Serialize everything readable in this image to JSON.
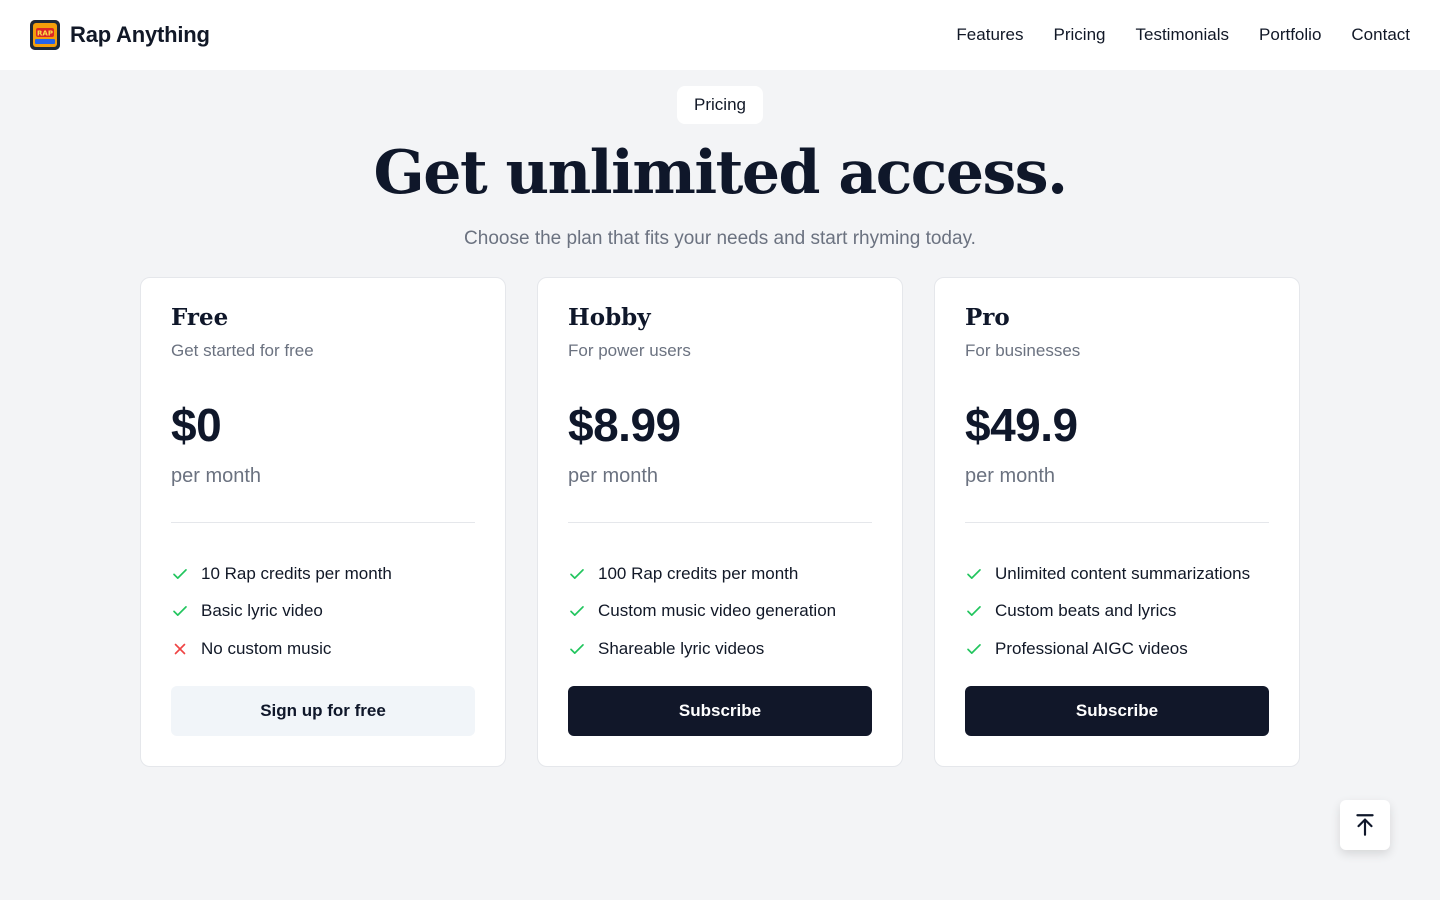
{
  "header": {
    "brand_name": "Rap Anything",
    "logo_text": "RAP",
    "nav": [
      "Features",
      "Pricing",
      "Testimonials",
      "Portfolio",
      "Contact"
    ]
  },
  "hero": {
    "badge": "Pricing",
    "title": "Get unlimited access.",
    "subtitle": "Choose the plan that fits your needs and start rhyming today."
  },
  "plans": [
    {
      "name": "Free",
      "description": "Get started for free",
      "price": "$0",
      "period": "per month",
      "features": [
        {
          "text": "10 Rap credits per month",
          "icon": "check-icon",
          "included": true
        },
        {
          "text": "Basic lyric video",
          "icon": "check-icon",
          "included": true
        },
        {
          "text": "No custom music",
          "icon": "x-icon",
          "included": false
        }
      ],
      "button": "Sign up for free",
      "button_style": "light"
    },
    {
      "name": "Hobby",
      "description": "For power users",
      "price": "$8.99",
      "period": "per month",
      "features": [
        {
          "text": "100 Rap credits per month",
          "icon": "check-icon",
          "included": true
        },
        {
          "text": "Custom music video generation",
          "icon": "check-icon",
          "included": true
        },
        {
          "text": "Shareable lyric videos",
          "icon": "check-icon",
          "included": true
        }
      ],
      "button": "Subscribe",
      "button_style": "dark"
    },
    {
      "name": "Pro",
      "description": "For businesses",
      "price": "$49.9",
      "period": "per month",
      "features": [
        {
          "text": "Unlimited content summarizations",
          "icon": "check-icon",
          "included": true
        },
        {
          "text": "Custom beats and lyrics",
          "icon": "check-icon",
          "included": true
        },
        {
          "text": "Professional AIGC videos",
          "icon": "check-icon",
          "included": true
        }
      ],
      "button": "Subscribe",
      "button_style": "dark"
    }
  ],
  "back_to_top_icon": "arrow-up-to-line-icon",
  "colors": {
    "check": "#22c55e",
    "cross": "#ef4444",
    "dark_button": "#111729",
    "light_button": "#f1f5f9",
    "page_bg": "#f3f4f6"
  }
}
